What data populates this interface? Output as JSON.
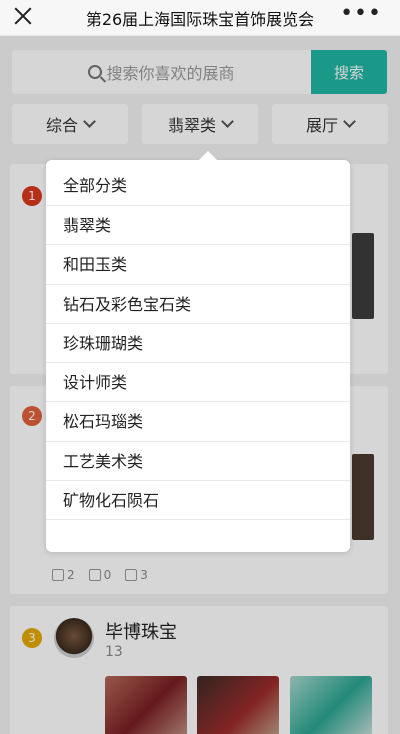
{
  "window": {
    "title": "第26届上海国际珠宝首饰展览会",
    "more_label": "•••"
  },
  "search": {
    "placeholder": "搜索你喜欢的展商",
    "button_label": "搜索"
  },
  "filters": [
    {
      "label": "综合"
    },
    {
      "label": "翡翠类"
    },
    {
      "label": "展厅"
    }
  ],
  "dropdown": {
    "items": [
      "全部分类",
      "翡翠类",
      "和田玉类",
      "钻石及彩色宝石类",
      "珍珠珊瑚类",
      "设计师类",
      "松石玛瑙类",
      "工艺美术类",
      "矿物化石陨石"
    ]
  },
  "cards": [
    {
      "rank": "1",
      "rank_color": "#d9381e"
    },
    {
      "rank": "2",
      "rank_color": "#e0603a",
      "likes": "2",
      "shares": "0",
      "views": "3"
    },
    {
      "rank": "3",
      "rank_color": "#e5a800",
      "name": "毕博珠宝",
      "count": "13"
    }
  ],
  "colors": {
    "accent": "#1fb5a2"
  }
}
